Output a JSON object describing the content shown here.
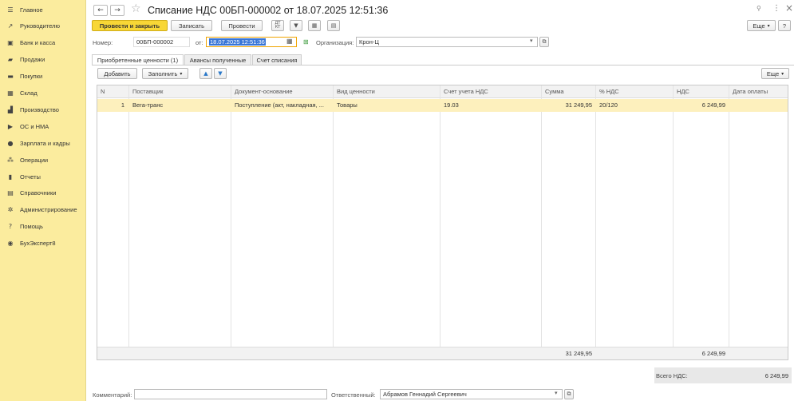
{
  "sidebar": {
    "items": [
      {
        "icon": "menu-icon",
        "glyph": "☰",
        "label": "Главное"
      },
      {
        "icon": "trend-icon",
        "glyph": "↗",
        "label": "Руководителю"
      },
      {
        "icon": "bank-icon",
        "glyph": "▣",
        "label": "Банк и касса"
      },
      {
        "icon": "bag-icon",
        "glyph": "▰",
        "label": "Продажи"
      },
      {
        "icon": "cart-icon",
        "glyph": "▬",
        "label": "Покупки"
      },
      {
        "icon": "warehouse-icon",
        "glyph": "▦",
        "label": "Склад"
      },
      {
        "icon": "factory-icon",
        "glyph": "▟",
        "label": "Производство"
      },
      {
        "icon": "truck-icon",
        "glyph": "▶",
        "label": "ОС и НМА"
      },
      {
        "icon": "person-icon",
        "glyph": "●",
        "label": "Зарплата и кадры"
      },
      {
        "icon": "operations-icon",
        "glyph": "⁂",
        "label": "Операции"
      },
      {
        "icon": "bar-chart-icon",
        "glyph": "▮",
        "label": "Отчеты"
      },
      {
        "icon": "book-icon",
        "glyph": "▤",
        "label": "Справочники"
      },
      {
        "icon": "gear-icon",
        "glyph": "✲",
        "label": "Администрирование"
      },
      {
        "icon": "help-icon",
        "glyph": "?",
        "label": "Помощь"
      },
      {
        "icon": "expert-icon",
        "glyph": "◉",
        "label": "БухЭксперт8"
      }
    ]
  },
  "header": {
    "title": "Списание НДС 00БП-000002 от 18.07.2025 12:51:36",
    "back_glyph": "←",
    "forward_glyph": "→",
    "star_glyph": "☆",
    "link_glyph": "🔗",
    "more_glyph": "⋮",
    "close_glyph": "×"
  },
  "toolbar": {
    "post_close": "Провести и закрыть",
    "save": "Записать",
    "post": "Провести",
    "more": "Еще",
    "help": "?"
  },
  "form": {
    "number_label": "Номер:",
    "number_value": "00БП-000002",
    "date_label": "от:",
    "date_value": "18.07.2025 12:51:36",
    "org_label": "Организация:",
    "org_value": "Крон-Ц"
  },
  "tabs": [
    "Приобретенные ценности (1)",
    "Авансы полученные",
    "Счет списания"
  ],
  "table_toolbar": {
    "add": "Добавить",
    "fill": "Заполнить",
    "more": "Еще"
  },
  "table": {
    "columns": [
      "N",
      "Поставщик",
      "Документ-основание",
      "Вид ценности",
      "Счет учета НДС",
      "Сумма",
      "% НДС",
      "НДС",
      "Дата оплаты"
    ],
    "rows": [
      {
        "n": "1",
        "supplier": "Вега-транс",
        "doc": "Поступление (акт, накладная, ...",
        "kind": "Товары",
        "account": "19.03",
        "sum": "31 249,95",
        "rate": "20/120",
        "vat": "6 249,99",
        "pay_date": ""
      }
    ],
    "totals": {
      "sum": "31 249,95",
      "vat": "6 249,99"
    }
  },
  "summary": {
    "label": "Всего НДС:",
    "value": "6 249,99"
  },
  "bottom": {
    "comment_label": "Комментарий:",
    "comment_value": "",
    "responsible_label": "Ответственный:",
    "responsible_value": "Абрамов Геннадий Сергеевич"
  }
}
